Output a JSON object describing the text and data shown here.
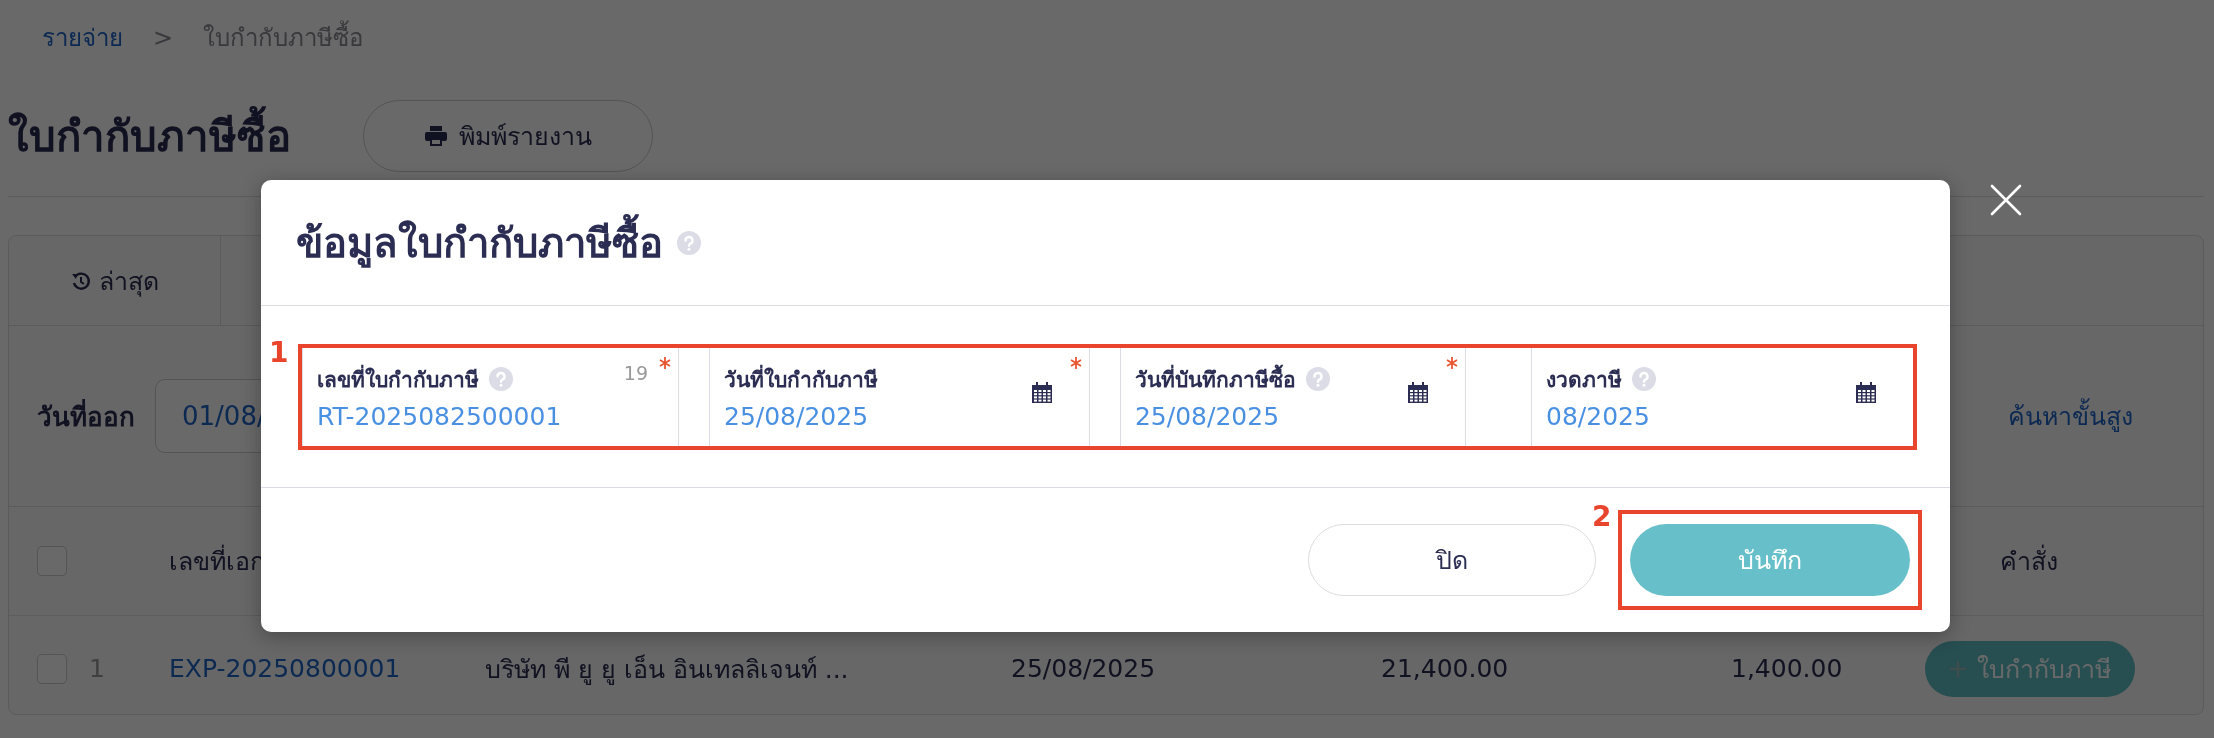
{
  "breadcrumb": {
    "parent": "รายจ่าย",
    "separator": ">",
    "current": "ใบกำกับภาษีซื้อ"
  },
  "page": {
    "title": "ใบกำกับภาษีซื้อ",
    "print_button": "พิมพ์รายงาน"
  },
  "tabs": [
    {
      "label": "ล่าสุด",
      "selected": true
    }
  ],
  "filter": {
    "label": "วันที่ออก",
    "date_value": "01/08/",
    "advanced_link": "ค้นหาขั้นสูง"
  },
  "table": {
    "header_checked": false,
    "columns": [
      "เลขที่เอก",
      "คำสั่ง"
    ],
    "rows": [
      {
        "checked": false,
        "index": "1",
        "doc_no": "EXP-20250800001",
        "company": "บริษัท พี ยู ยู เอ็น อินเทลลิเจนท์ ...",
        "date": "25/08/2025",
        "amount": "21,400.00",
        "tax": "1,400.00",
        "action": "ใบกำกับภาษี"
      }
    ]
  },
  "modal": {
    "title": "ข้อมูลใบกำกับภาษีซื้อ",
    "help": true,
    "fields": [
      {
        "label": "เลขที่ใบกำกับภาษี",
        "help": true,
        "counter": "19",
        "required": true,
        "value": "RT-2025082500001",
        "kind": "text"
      },
      {
        "label": "วันที่ใบกำกับภาษี",
        "help": false,
        "required": true,
        "value": "25/08/2025",
        "kind": "date"
      },
      {
        "label": "วันที่บันทึกภาษีซื้อ",
        "help": true,
        "required": true,
        "value": "25/08/2025",
        "kind": "date"
      },
      {
        "label": "งวดภาษี",
        "help": true,
        "required": false,
        "value": "08/2025",
        "kind": "date"
      }
    ],
    "buttons": [
      {
        "label": "ปิด",
        "kind": "secondary"
      },
      {
        "label": "บันทึก",
        "kind": "primary"
      }
    ]
  },
  "annotations": [
    {
      "label": "1"
    },
    {
      "label": "2"
    }
  ]
}
